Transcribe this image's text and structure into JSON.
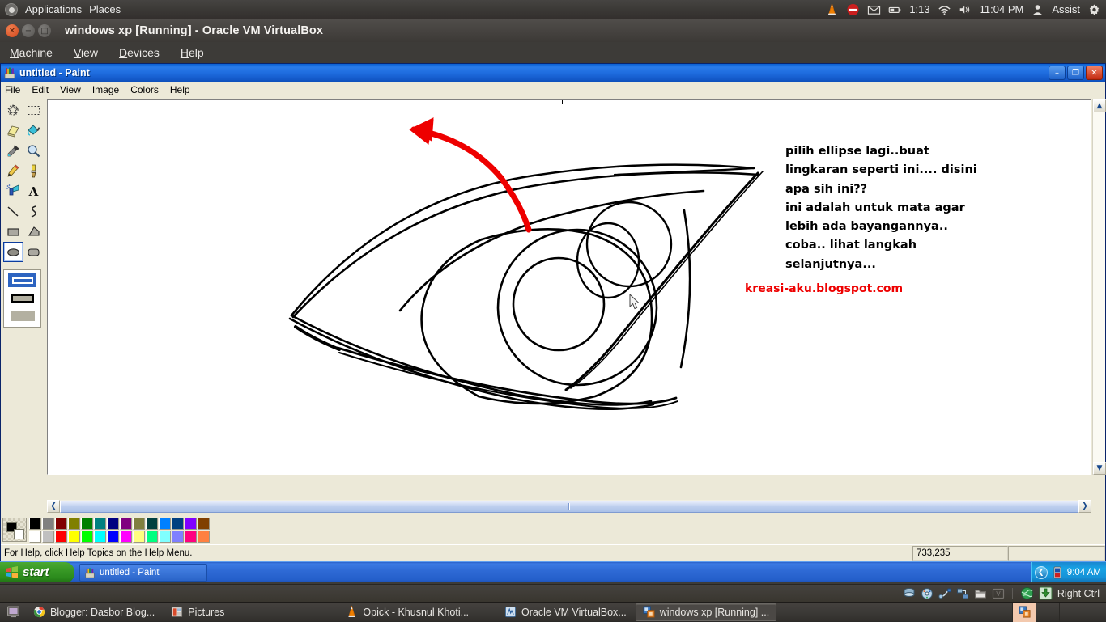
{
  "gnome_panel": {
    "applications_label": "Applications",
    "places_label": "Places",
    "battery_time": "1:13",
    "clock": "11:04 PM",
    "user_label": "Assist",
    "icons": [
      "ubuntu-logo-icon",
      "vlc-cone-icon",
      "do-not-disturb-icon",
      "mail-envelope-icon",
      "battery-icon",
      "wifi-icon",
      "volume-icon",
      "user-icon",
      "gear-icon"
    ]
  },
  "vbox_window": {
    "title": "windows xp [Running] - Oracle VM VirtualBox",
    "close_glyph": "✕",
    "min_glyph": "−",
    "max_glyph": "□",
    "menu": [
      {
        "label": "Machine",
        "mnemonic": "M"
      },
      {
        "label": "View",
        "mnemonic": "V"
      },
      {
        "label": "Devices",
        "mnemonic": "D"
      },
      {
        "label": "Help",
        "mnemonic": "H"
      }
    ]
  },
  "vbox_statusbar": {
    "host_key": "Right Ctrl",
    "icons": [
      "hard-disk-icon",
      "cd-dvd-icon",
      "usb-icon",
      "network-icon",
      "shared-folder-icon",
      "vm-display-icon",
      "globe-icon",
      "download-icon"
    ]
  },
  "paint_window": {
    "title": "untitled - Paint",
    "titlebar_buttons": {
      "minimize": "–",
      "restore": "❐",
      "close": "✕"
    },
    "menu": [
      "File",
      "Edit",
      "View",
      "Image",
      "Colors",
      "Help"
    ],
    "toolbox": [
      {
        "name": "free-form-select-tool",
        "selected": false
      },
      {
        "name": "rectangle-select-tool",
        "selected": false
      },
      {
        "name": "eraser-tool",
        "selected": false
      },
      {
        "name": "fill-with-color-tool",
        "selected": false
      },
      {
        "name": "pick-color-tool",
        "selected": false
      },
      {
        "name": "magnifier-tool",
        "selected": false
      },
      {
        "name": "pencil-tool",
        "selected": false
      },
      {
        "name": "brush-tool",
        "selected": false
      },
      {
        "name": "airbrush-tool",
        "selected": false
      },
      {
        "name": "text-tool",
        "selected": false
      },
      {
        "name": "line-tool",
        "selected": false
      },
      {
        "name": "curve-tool",
        "selected": false
      },
      {
        "name": "rectangle-tool",
        "selected": false
      },
      {
        "name": "polygon-tool",
        "selected": false
      },
      {
        "name": "ellipse-tool",
        "selected": true
      },
      {
        "name": "rounded-rectangle-tool",
        "selected": false
      }
    ],
    "fill_options": [
      {
        "name": "outline-only-option",
        "selected": true
      },
      {
        "name": "outline-and-fill-option",
        "selected": false
      },
      {
        "name": "fill-only-option",
        "selected": false
      }
    ],
    "statusbar": {
      "help_text": "For Help, click Help Topics on the Help Menu.",
      "cursor_position": "733,235",
      "selection_size": ""
    },
    "scrollbars": {
      "left_arrow": "❮",
      "right_arrow": "❯",
      "up_arrow": "▲",
      "down_arrow": "▼"
    },
    "palette": {
      "foreground_color": "#000000",
      "background_color": "#ffffff",
      "row_top": [
        "#000000",
        "#808080",
        "#800000",
        "#808000",
        "#008000",
        "#008080",
        "#000080",
        "#800080",
        "#808040",
        "#004040",
        "#0080ff",
        "#004080",
        "#8000ff",
        "#804000"
      ],
      "row_bottom": [
        "#ffffff",
        "#c0c0c0",
        "#ff0000",
        "#ffff00",
        "#00ff00",
        "#00ffff",
        "#0000ff",
        "#ff00ff",
        "#ffff80",
        "#00ff80",
        "#80ffff",
        "#8080ff",
        "#ff0080",
        "#ff8040"
      ]
    }
  },
  "canvas": {
    "annotation_lines": [
      "pilih ellipse lagi..buat",
      "lingkaran seperti ini.... disini",
      "apa sih ini??",
      "ini adalah untuk mata agar",
      "lebih ada bayangannya..",
      "coba.. lihat langkah",
      "selanjutnya..."
    ],
    "watermark": "kreasi-aku.blogspot.com",
    "watermark_color": "#ee0000",
    "arrow_color": "#ee0000",
    "stroke_color": "#000000",
    "drawing_description": "hand-drawn eye outline with several overlapping ellipses for iris, pupil and highlight"
  },
  "xp_taskbar": {
    "start_label": "start",
    "task_button_label": "untitled - Paint",
    "tray_clock": "9:04 AM",
    "tray_chevron": "❮",
    "tray_icons": [
      "notification-battery-icon"
    ]
  },
  "bottom_panel": {
    "show_desktop_icon": "show-desktop-icon",
    "windows": [
      {
        "label": "Blogger: Dasbor Blog...",
        "icon": "chrome-icon",
        "active": false
      },
      {
        "label": "Pictures",
        "icon": "folder-pictures-icon",
        "active": false
      },
      {
        "label": "Opick - Khusnul Khoti...",
        "icon": "vlc-cone-icon",
        "active": false
      },
      {
        "label": "Oracle VM VirtualBox...",
        "icon": "virtualbox-manager-icon",
        "active": false
      },
      {
        "label": "windows xp [Running] ...",
        "icon": "virtualbox-vm-icon",
        "active": true
      }
    ],
    "workspaces": [
      {
        "name": "workspace-1",
        "current": true
      },
      {
        "name": "workspace-2",
        "current": false
      },
      {
        "name": "workspace-3",
        "current": false
      },
      {
        "name": "workspace-4",
        "current": false
      }
    ]
  }
}
